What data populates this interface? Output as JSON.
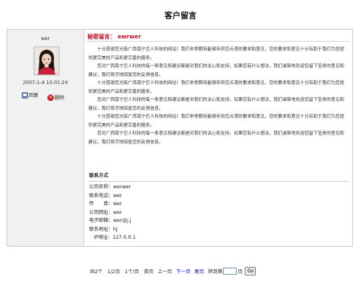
{
  "page": {
    "title": "客户留言"
  },
  "message": {
    "username": "wer",
    "datetime": "2007-1-4 10:01:24",
    "reply_label": "回复",
    "delete_label": "删除",
    "secret_label": "秘密留言：",
    "secret_value": "ewrwer",
    "paragraphs": [
      "十分感谢您光临广西南宁巨人科技的网站！我们非常期待能够听到您点滴的要求和意见，您的要求和意见十分有助于我们为您提供更完美的产品和更完善的服务。",
      "您对广西南宁巨人科技的每一条意见和建议都是对我们的关心和支持，如果您有什么想法，我们诚挚地欢迎您留下宝贵的意见和建议，我们将尽快回复您的反馈信息。",
      "十分感谢您光临广西南宁巨人科技的网站！我们非常期待能够听到您点滴的要求和意见，您的要求和意见十分有助于我们为您提供更完美的产品和更完善的服务。",
      "您对广西南宁巨人科技的每一条意见和建议都是对我们的关心和支持，如果您有什么想法，我们诚挚地欢迎您留下宝贵的意见和建议，我们将尽快回复您的反馈信息。",
      "十分感谢您光临广西南宁巨人科技的网站！我们非常期待能够听到您点滴的要求和意见，您的要求和意见十分有助于我们为您提供更完美的产品和更完善的服务。",
      "您对广西南宁巨人科技的每一条意见和建议都是对我们的关心和支持，如果您有什么想法，我们诚挚地欢迎您留下宝贵的意见和建议，我们将尽快回复您的反馈信息。"
    ]
  },
  "contact": {
    "header": "联系方式",
    "rows": [
      {
        "label": "公司名称：",
        "value": "werwer"
      },
      {
        "label": "联系电话：",
        "value": "wer"
      },
      {
        "label": "传　　真：",
        "value": "wer"
      },
      {
        "label": "公司网址：",
        "value": "wer"
      },
      {
        "label": "电子邮箱：",
        "value": "wer@j.j"
      },
      {
        "label": "联系地址：",
        "value": "hj"
      },
      {
        "label": "IP地址：",
        "value": "127.0.0.1"
      }
    ]
  },
  "pagination": {
    "total": "共2个",
    "page_of": "1/2页",
    "per_page": "1个/页",
    "first": "首页",
    "prev": "上一页",
    "next": "下一页",
    "last": "尾页",
    "goto_label": "转到第",
    "goto_suffix": "页",
    "go_label": "Go",
    "colors": {
      "link": "#0000cc",
      "accent": "#c0102a"
    }
  }
}
